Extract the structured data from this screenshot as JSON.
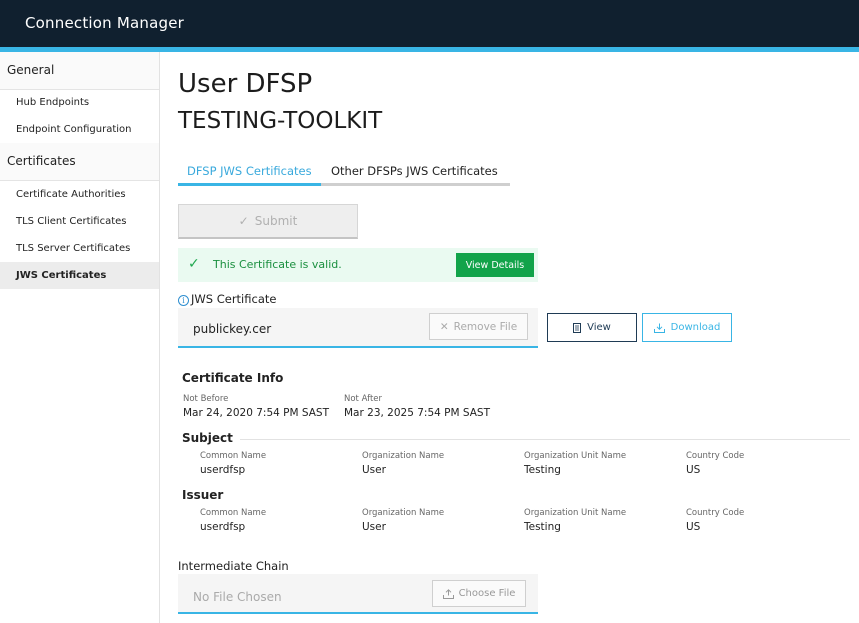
{
  "header": {
    "title": "Connection Manager"
  },
  "sidebar": {
    "sections": [
      {
        "label": "General",
        "items": [
          "Hub Endpoints",
          "Endpoint Configuration"
        ]
      },
      {
        "label": "Certificates",
        "items": [
          "Certificate Authorities",
          "TLS Client Certificates",
          "TLS Server Certificates",
          "JWS Certificates"
        ]
      }
    ],
    "active_item": "JWS Certificates"
  },
  "main": {
    "title": "User DFSP",
    "subtitle": "TESTING-TOOLKIT",
    "tabs": [
      {
        "label": "DFSP JWS Certificates",
        "active": true
      },
      {
        "label": "Other DFSPs JWS Certificates",
        "active": false
      }
    ],
    "submit_label": "Submit",
    "status": {
      "text": "This Certificate is valid.",
      "details_label": "View Details"
    },
    "jws_field": {
      "label": "JWS Certificate",
      "file_name": "publickey.cer",
      "remove_label": "Remove File"
    },
    "view_label": "View",
    "download_label": "Download",
    "cert_info": {
      "title": "Certificate Info",
      "not_before_label": "Not Before",
      "not_before": "Mar 24, 2020 7:54 PM SAST",
      "not_after_label": "Not After",
      "not_after": "Mar 23, 2025 7:54 PM SAST"
    },
    "subject": {
      "title": "Subject",
      "fields": [
        {
          "label": "Common Name",
          "value": "userdfsp"
        },
        {
          "label": "Organization Name",
          "value": "User"
        },
        {
          "label": "Organization Unit Name",
          "value": "Testing"
        },
        {
          "label": "Country Code",
          "value": "US"
        }
      ]
    },
    "issuer": {
      "title": "Issuer",
      "fields": [
        {
          "label": "Common Name",
          "value": "userdfsp"
        },
        {
          "label": "Organization Name",
          "value": "User"
        },
        {
          "label": "Organization Unit Name",
          "value": "Testing"
        },
        {
          "label": "Country Code",
          "value": "US"
        }
      ]
    },
    "chain": {
      "label": "Intermediate Chain",
      "placeholder": "No File Chosen",
      "choose_label": "Choose File"
    }
  },
  "colors": {
    "header_bg": "#10202f",
    "accent": "#39b5e5",
    "success": "#12a34a",
    "navy": "#1f3b55"
  },
  "icons": [
    "check-icon",
    "info-icon",
    "close-icon",
    "document-icon",
    "download-icon",
    "upload-icon"
  ]
}
